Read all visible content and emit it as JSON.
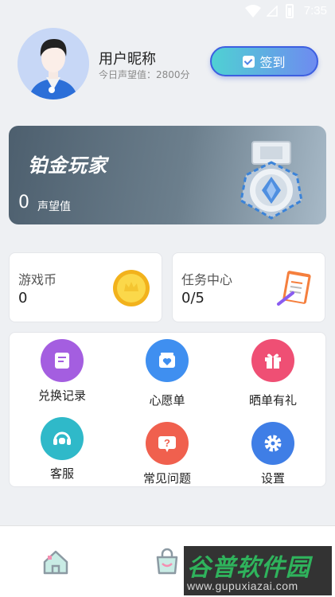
{
  "status_bar": {
    "time": "7:35"
  },
  "profile": {
    "username": "用户昵称",
    "reputation_today": "今日声望值：2800分",
    "checkin_label": "签到"
  },
  "level_card": {
    "title": "铂金玩家",
    "reputation_value": "0",
    "reputation_label": "声望值"
  },
  "stats": {
    "coins": {
      "label": "游戏币",
      "value": "0"
    },
    "tasks": {
      "label": "任务中心",
      "value": "0/5"
    }
  },
  "menu": {
    "items": [
      {
        "label": "兑换记录",
        "icon": "clipboard-icon",
        "color": "#a45ee0"
      },
      {
        "label": "心愿单",
        "icon": "heart-box-icon",
        "color": "#3f8ff0"
      },
      {
        "label": "晒单有礼",
        "icon": "gift-icon",
        "color": "#ef4f74"
      },
      {
        "label": "客服",
        "icon": "headset-icon",
        "color": "#2fb9c9"
      },
      {
        "label": "常见问题",
        "icon": "question-icon",
        "color": "#f0604e"
      },
      {
        "label": "设置",
        "icon": "gear-icon",
        "color": "#3f7ee6"
      }
    ]
  },
  "bottom_nav": {
    "items": [
      "home-icon",
      "wishlist-bag-icon"
    ]
  },
  "watermark": {
    "title": "谷普软件园",
    "url": "www.gupuxiazai.com"
  }
}
